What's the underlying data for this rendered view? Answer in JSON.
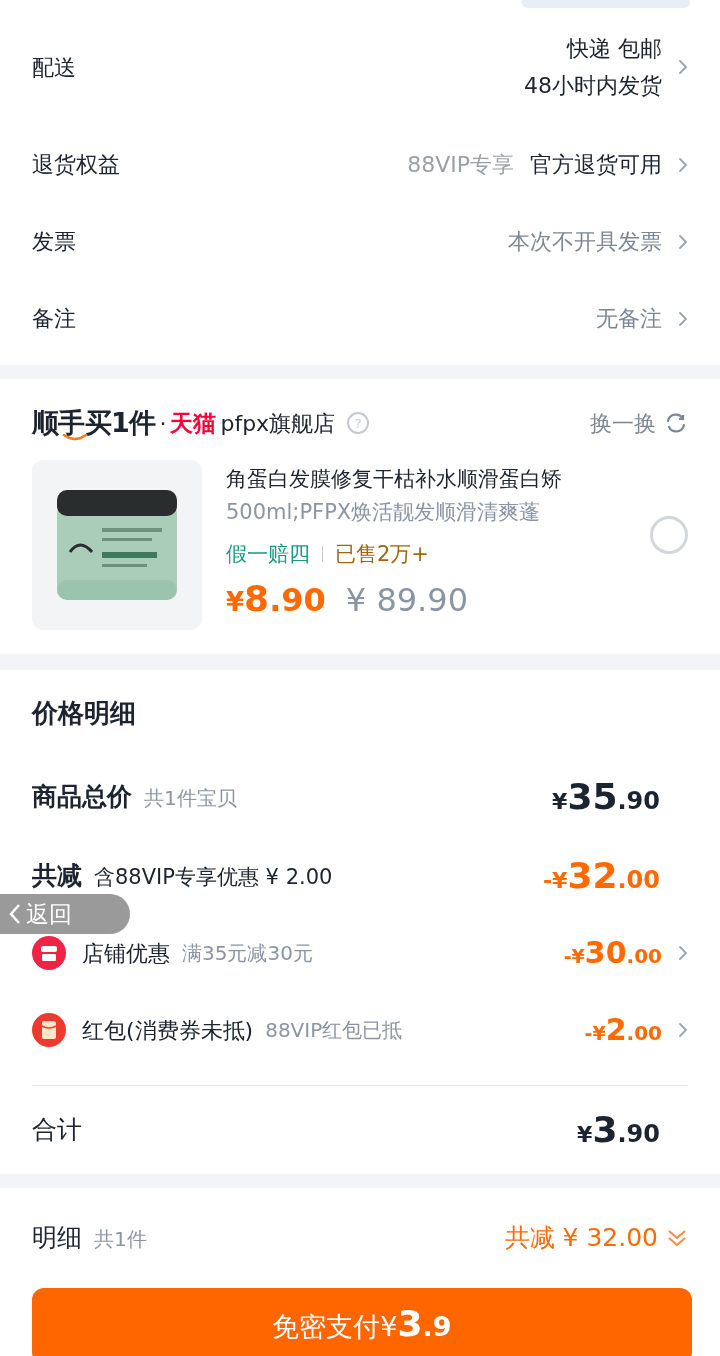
{
  "order_rows": [
    {
      "label": "配送",
      "kind": "two_line",
      "lines": [
        "快递 包邮",
        "48小时内发货"
      ]
    },
    {
      "label": "退货权益",
      "kind": "tagged",
      "tag": "88VIP专享",
      "value": "官方退货可用"
    },
    {
      "label": "发票",
      "kind": "muted",
      "value": "本次不开具发票"
    },
    {
      "label": "备注",
      "kind": "muted",
      "value": "无备注"
    }
  ],
  "recommend": {
    "logo": "顺手买1件",
    "dot": "·",
    "mall": "天猫",
    "store": "pfpx旗舰店",
    "help": "?",
    "swap": "换一换",
    "product": {
      "kind": "picture",
      "title": "角蛋白发膜修复干枯补水顺滑蛋白矫",
      "subtitle": "500ml;PFPX焕活靓发顺滑清爽蓬",
      "guarantee": "假一赔四",
      "sold": "已售2万+",
      "price": {
        "currency": "¥",
        "integer": "8",
        "decimal": ".90"
      },
      "original_price": "¥ 89.90",
      "selected": false
    }
  },
  "price_detail": {
    "title": "价格明细",
    "total": {
      "label": "商品总价",
      "note": "共1件宝贝",
      "price": {
        "prefix": "¥",
        "integer": "35",
        "decimal": ".90"
      }
    },
    "discount": {
      "label": "共减",
      "note": "含88VIP专享优惠 ¥ 2.00",
      "price": {
        "prefix": "-¥",
        "integer": "32",
        "decimal": ".00"
      }
    },
    "items": [
      {
        "kind": "store",
        "label": "店铺优惠",
        "note": "满35元减30元",
        "price": {
          "prefix": "-¥",
          "integer": "30",
          "decimal": ".00"
        }
      },
      {
        "kind": "red_packet",
        "label": "红包(消费券未抵)",
        "note": "88VIP红包已抵",
        "price": {
          "prefix": "-¥",
          "integer": "2",
          "decimal": ".00"
        }
      }
    ],
    "sum": {
      "label": "合计",
      "price": {
        "prefix": "¥",
        "integer": "3",
        "decimal": ".90"
      }
    }
  },
  "footer": {
    "label": "明细",
    "count": "共1件",
    "saving": "共减 ¥ 32.00",
    "expanded": false,
    "pay_button": {
      "label": "免密支付¥",
      "integer": "3",
      "decimal": ".9"
    }
  },
  "back_overlay": {
    "label": "返回"
  }
}
